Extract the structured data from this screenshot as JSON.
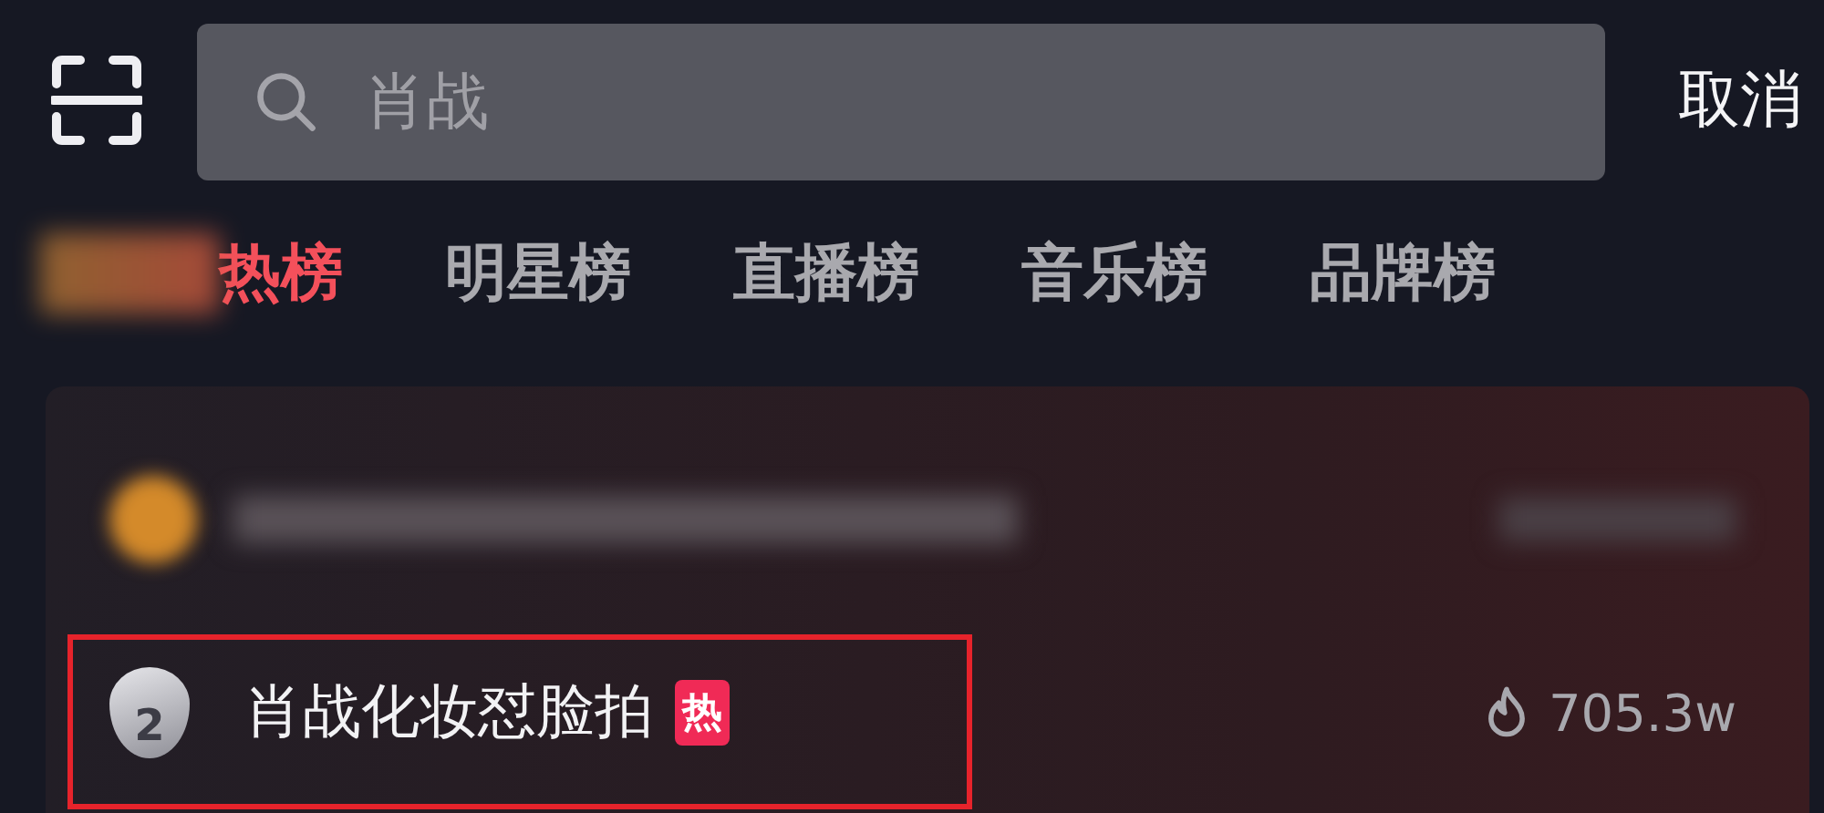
{
  "search": {
    "placeholder": "肖战",
    "cancel": "取消"
  },
  "tabs": [
    {
      "label": "热榜",
      "selected": true,
      "blurred_prefix": true
    },
    {
      "label": "明星榜",
      "selected": false
    },
    {
      "label": "直播榜",
      "selected": false
    },
    {
      "label": "音乐榜",
      "selected": false
    },
    {
      "label": "品牌榜",
      "selected": false
    }
  ],
  "rows": [
    {
      "kind": "blurred"
    },
    {
      "kind": "item",
      "rank": "2",
      "title": "肖战化妆怼脸拍",
      "tag": "热",
      "heat": "705.3w",
      "highlighted": true
    }
  ]
}
